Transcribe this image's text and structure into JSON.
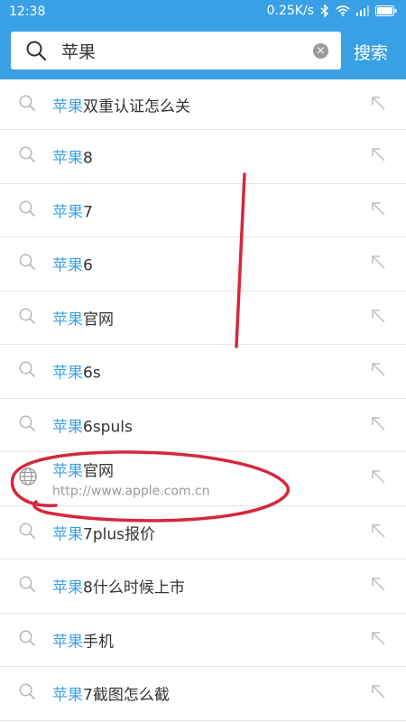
{
  "status_bar": {
    "time": "12:38",
    "speed": "0.25K/s"
  },
  "search": {
    "query": "苹果",
    "button_label": "搜索"
  },
  "suggestions": [
    {
      "keyword": "苹果",
      "suffix": "双重认证怎么关",
      "icon": "search-icon"
    },
    {
      "keyword": "苹果",
      "suffix": "8",
      "icon": "search-icon"
    },
    {
      "keyword": "苹果",
      "suffix": "7",
      "icon": "search-icon"
    },
    {
      "keyword": "苹果",
      "suffix": "6",
      "icon": "search-icon"
    },
    {
      "keyword": "苹果",
      "suffix": "官网",
      "icon": "search-icon"
    },
    {
      "keyword": "苹果",
      "suffix": "6s",
      "icon": "search-icon"
    },
    {
      "keyword": "苹果",
      "suffix": "6spuls",
      "icon": "search-icon"
    },
    {
      "keyword": "苹果",
      "suffix": "官网",
      "url": "http://www.apple.com.cn",
      "icon": "globe-icon"
    },
    {
      "keyword": "苹果",
      "suffix": "7plus报价",
      "icon": "search-icon"
    },
    {
      "keyword": "苹果",
      "suffix": "8什么时候上市",
      "icon": "search-icon"
    },
    {
      "keyword": "苹果",
      "suffix": "手机",
      "icon": "search-icon"
    },
    {
      "keyword": "苹果",
      "suffix": "7截图怎么截",
      "icon": "search-icon"
    }
  ],
  "colors": {
    "accent": "#3aa0e6",
    "annotation": "#d4283c"
  }
}
